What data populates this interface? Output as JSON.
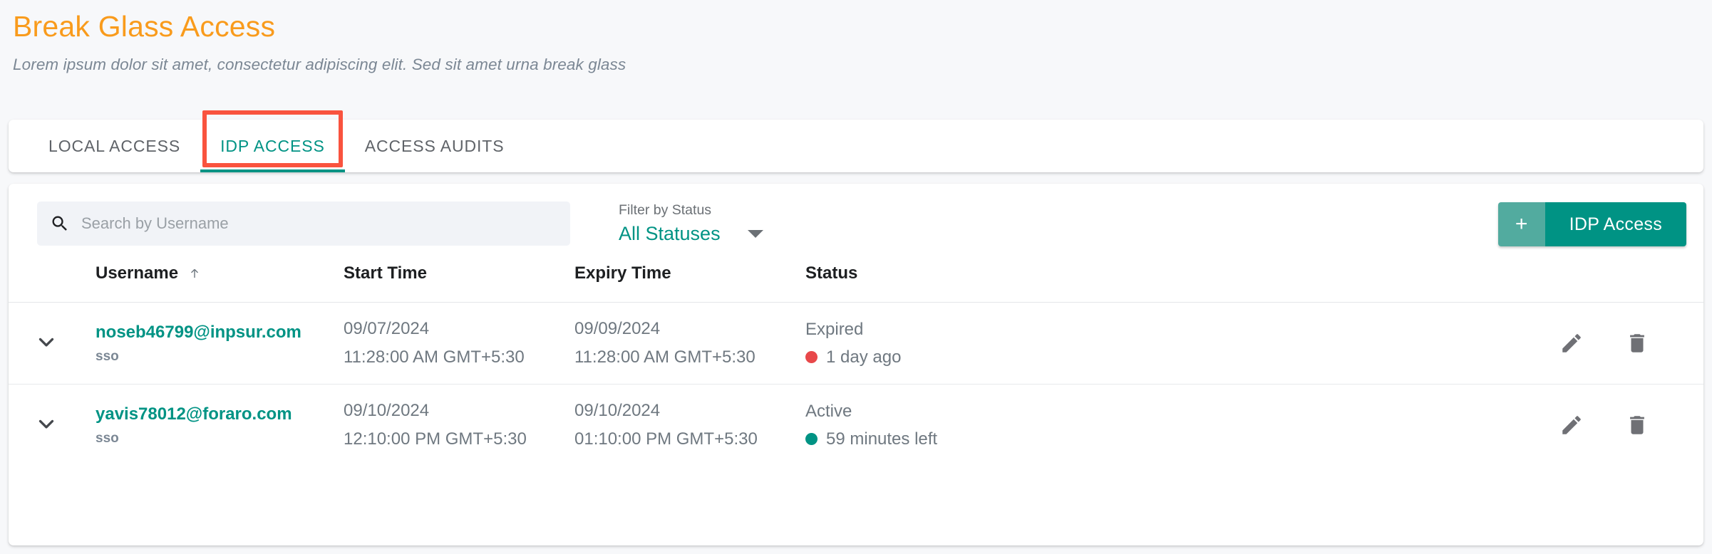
{
  "header": {
    "title": "Break Glass Access",
    "subtitle": "Lorem ipsum dolor sit amet, consectetur adipiscing elit. Sed sit amet urna break glass",
    "title_color": "#f99b1c"
  },
  "tabs": [
    {
      "label": "LOCAL ACCESS",
      "active": false
    },
    {
      "label": "IDP ACCESS",
      "active": true,
      "annotated": true
    },
    {
      "label": "ACCESS AUDITS",
      "active": false
    }
  ],
  "toolbar": {
    "search_placeholder": "Search by Username",
    "search_value": "",
    "search_icon": "search-icon",
    "filter_label": "Filter by Status",
    "filter_value": "All Statuses",
    "filter_options": [
      "All Statuses"
    ],
    "add_button_plus": "+",
    "add_button_label": "IDP Access",
    "accent_color": "#009384"
  },
  "table": {
    "columns": [
      {
        "key": "username",
        "label": "Username",
        "sort": "asc"
      },
      {
        "key": "start_time",
        "label": "Start Time"
      },
      {
        "key": "expiry_time",
        "label": "Expiry Time"
      },
      {
        "key": "status",
        "label": "Status"
      }
    ],
    "rows": [
      {
        "expand_icon": "chevron-down-icon",
        "username": "noseb46799@inpsur.com",
        "user_type": "sso",
        "start_date": "09/07/2024",
        "start_time": "11:28:00 AM GMT+5:30",
        "expiry_date": "09/09/2024",
        "expiry_time": "11:28:00 AM GMT+5:30",
        "status": "Expired",
        "status_detail": "1 day ago",
        "status_color": "#e8484a",
        "edit_icon": "pencil-icon",
        "delete_icon": "trash-icon"
      },
      {
        "expand_icon": "chevron-down-icon",
        "username": "yavis78012@foraro.com",
        "user_type": "sso",
        "start_date": "09/10/2024",
        "start_time": "12:10:00 PM GMT+5:30",
        "expiry_date": "09/10/2024",
        "expiry_time": "01:10:00 PM GMT+5:30",
        "status": "Active",
        "status_detail": "59 minutes left",
        "status_color": "#009384",
        "edit_icon": "pencil-icon",
        "delete_icon": "trash-icon"
      }
    ]
  },
  "annotation": {
    "color": "#f9533e",
    "target": "IDP ACCESS"
  }
}
